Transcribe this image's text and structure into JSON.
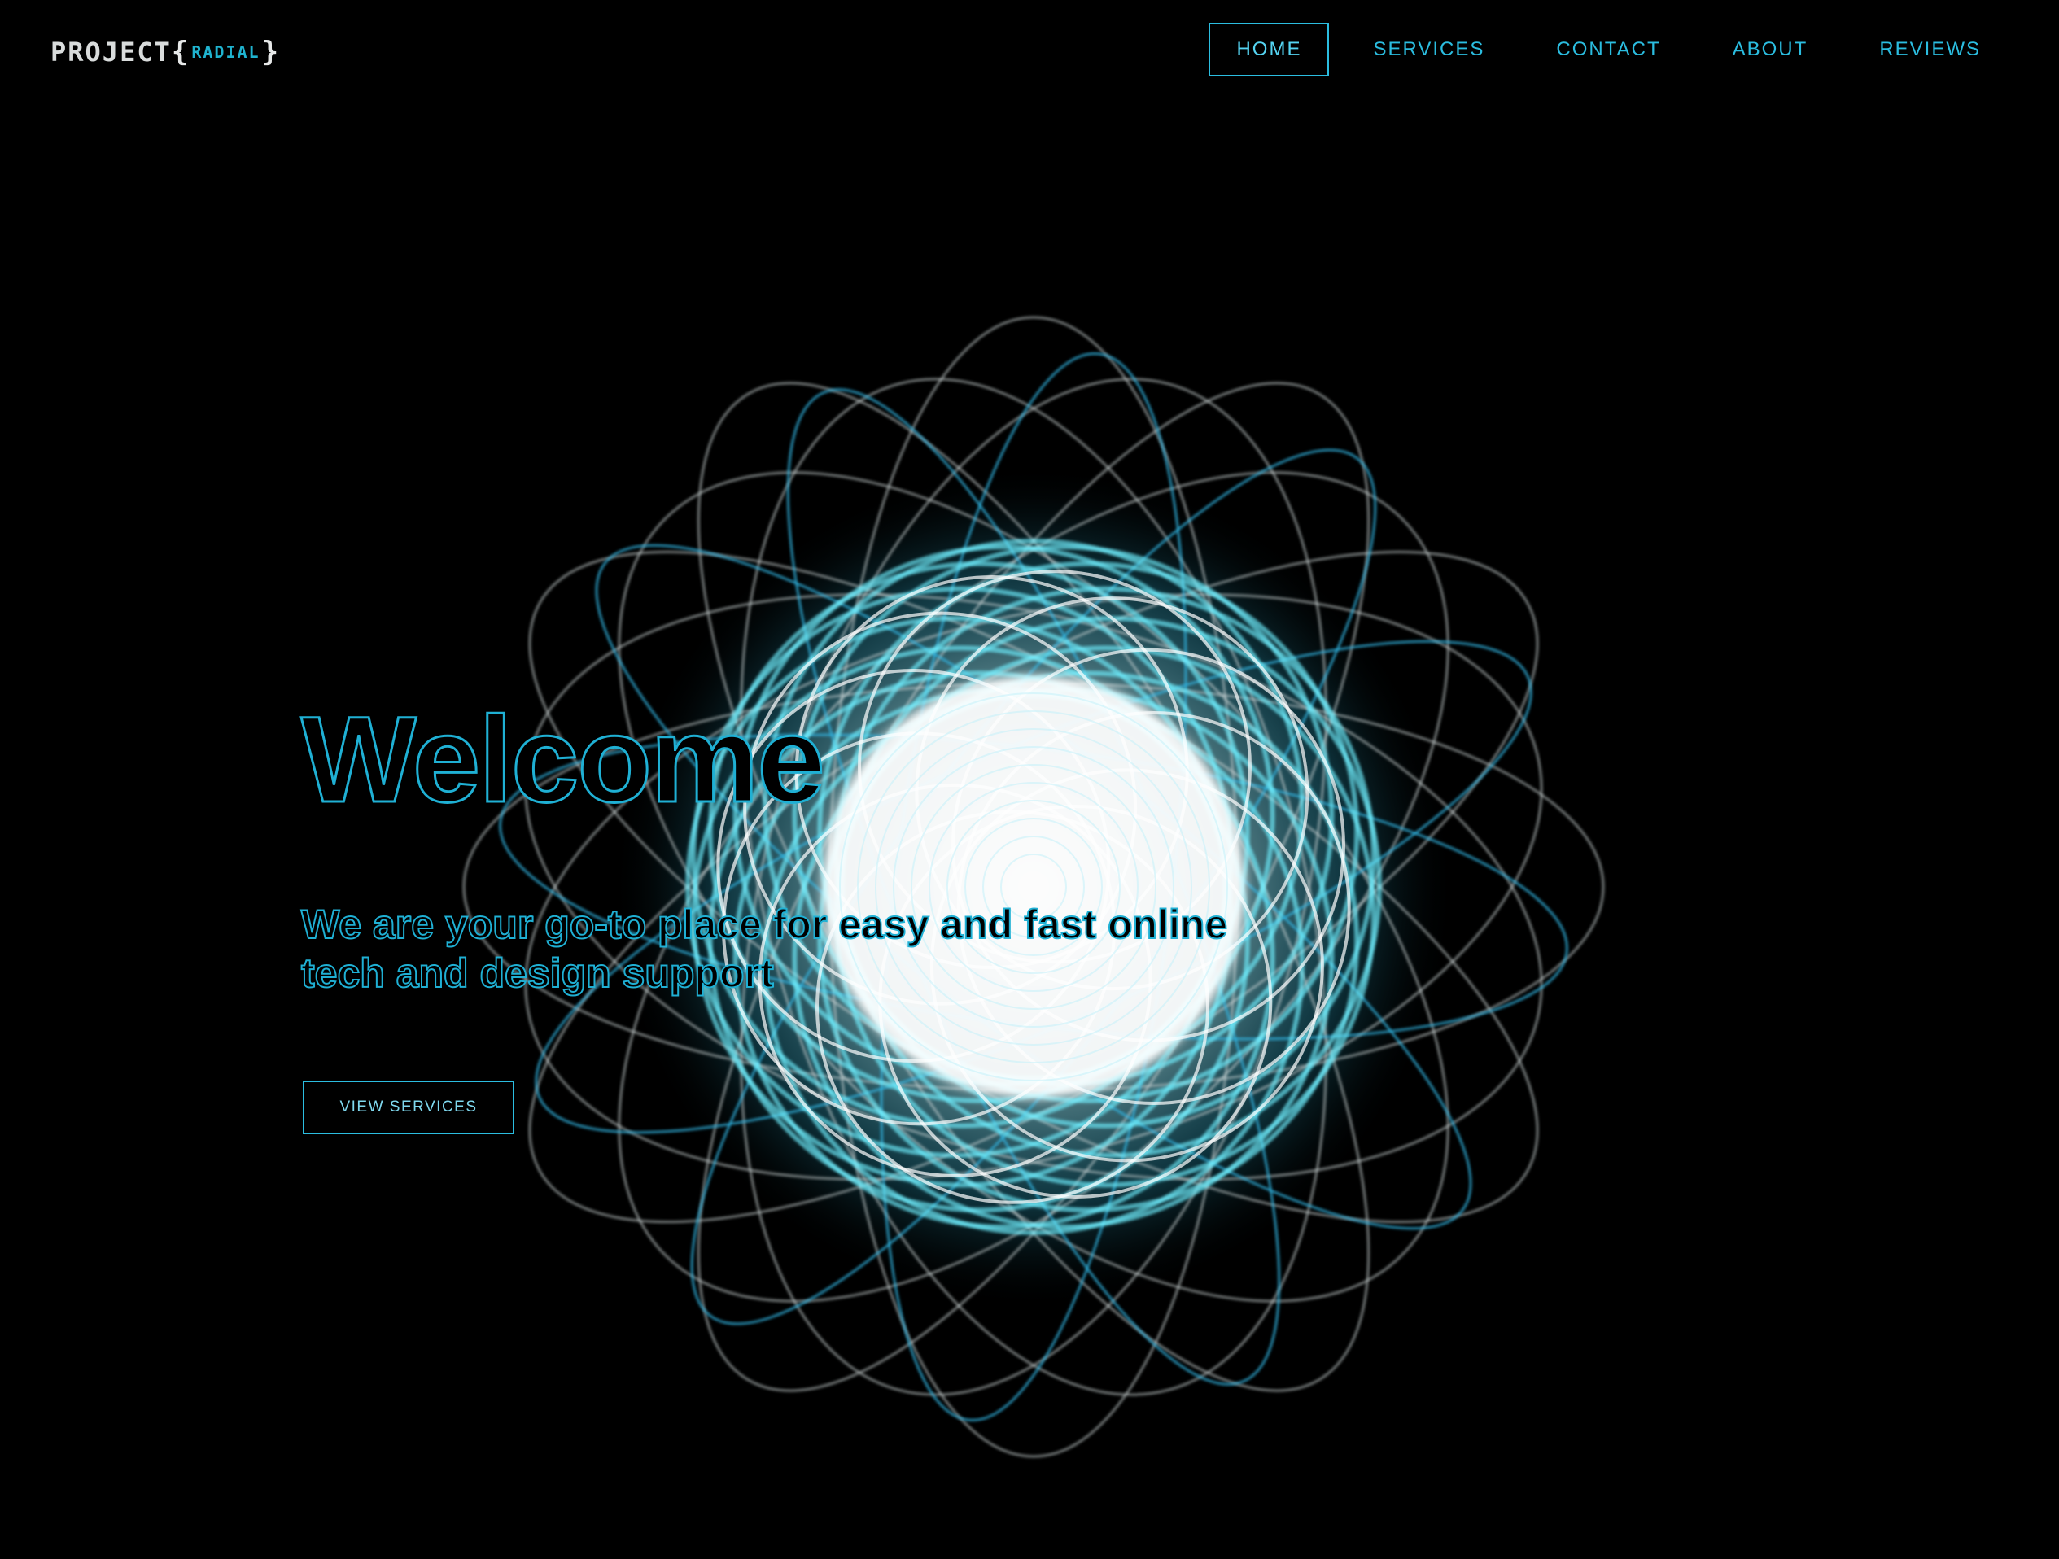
{
  "brand": {
    "logo_main": "PROJECT",
    "logo_open_brace": "{",
    "logo_accent": "RADIAL",
    "logo_close_brace": "}"
  },
  "nav": {
    "items": [
      {
        "label": "HOME",
        "active": true
      },
      {
        "label": "SERVICES",
        "active": false
      },
      {
        "label": "CONTACT",
        "active": false
      },
      {
        "label": "ABOUT",
        "active": false
      },
      {
        "label": "REVIEWS",
        "active": false
      }
    ]
  },
  "hero": {
    "title": "Welcome",
    "subtitle": "We are your go-to place for easy and fast online tech and design support",
    "cta_label": "VIEW SERVICES"
  },
  "colors": {
    "background": "#000000",
    "accent": "#2bbde0",
    "glow_core": "#ffffff",
    "glow_mid": "#5fe6ff",
    "glow_outer": "#1aa7d6"
  }
}
